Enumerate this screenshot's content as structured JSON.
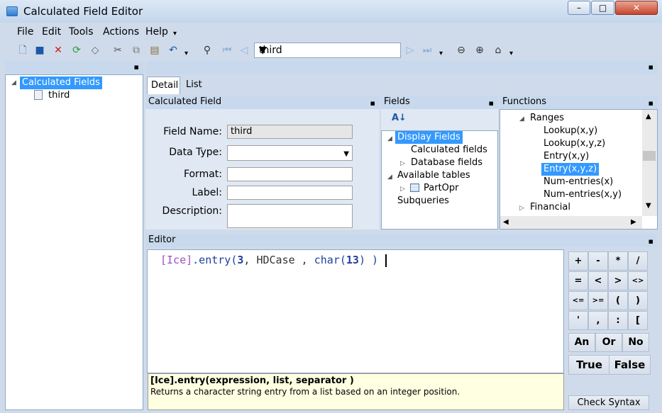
{
  "window": {
    "title": "Calculated Field Editor",
    "minimize": "–",
    "maximize": "□",
    "close": "✕"
  },
  "menu": {
    "file": "File",
    "edit": "Edit",
    "tools": "Tools",
    "actions": "Actions",
    "help": "Help"
  },
  "toolbar": {
    "nav_value": "third"
  },
  "left_tree": {
    "root": "Calculated Fields",
    "child": "third"
  },
  "tabs": {
    "detail": "Detail",
    "list": "List"
  },
  "calc_field": {
    "header": "Calculated Field",
    "field_name_label": "Field Name:",
    "field_name_value": "third",
    "data_type_label": "Data Type:",
    "format_label": "Format:",
    "label_label": "Label:",
    "description_label": "Description:"
  },
  "fields": {
    "header": "Fields",
    "display_fields": "Display Fields",
    "calculated_fields": "Calculated fields",
    "database_fields": "Database fields",
    "available_tables": "Available tables",
    "partopr": "PartOpr",
    "subqueries": "Subqueries"
  },
  "functions": {
    "header": "Functions",
    "ranges": "Ranges",
    "items": [
      "Lookup(x,y)",
      "Lookup(x,y,z)",
      "Entry(x,y)",
      "Entry(x,y,z)",
      "Num-entries(x)",
      "Num-entries(x,y)"
    ],
    "financial": "Financial"
  },
  "editor": {
    "header": "Editor",
    "code": {
      "p1": "[Ice]",
      "p2": ".entry(",
      "p3": "3",
      "p4": ", HDCase , ",
      "p5": "char(",
      "p6": "13",
      "p7": ") )"
    },
    "help_signature": "[Ice].entry(expression, list, separator )",
    "help_desc": "Returns a character string entry from a list based on an integer position."
  },
  "calc": {
    "row1": [
      "+",
      "-",
      "*",
      "/"
    ],
    "row2": [
      "=",
      "<",
      ">",
      "<>"
    ],
    "row3": [
      "<=",
      ">=",
      "(",
      ")"
    ],
    "row4": [
      "'",
      ",",
      ":",
      "["
    ],
    "row5": [
      "An",
      "Or",
      "No"
    ],
    "row6": [
      "True",
      "False"
    ],
    "check_syntax": "Check Syntax"
  }
}
